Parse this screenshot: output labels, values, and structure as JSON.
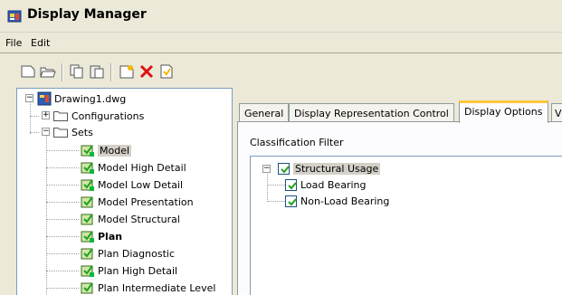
{
  "window": {
    "title": "Display Manager"
  },
  "menu": {
    "file": "File",
    "edit": "Edit"
  },
  "tree": {
    "root": "Drawing1.dwg",
    "configurations": "Configurations",
    "sets": "Sets",
    "items": [
      {
        "label": "Model",
        "selected": true,
        "bold": false
      },
      {
        "label": "Model High Detail"
      },
      {
        "label": "Model Low Detail"
      },
      {
        "label": "Model Presentation"
      },
      {
        "label": "Model Structural"
      },
      {
        "label": "Plan",
        "bold": true
      },
      {
        "label": "Plan Diagnostic"
      },
      {
        "label": "Plan High Detail"
      },
      {
        "label": "Plan Intermediate Level"
      }
    ]
  },
  "tabs": [
    {
      "label": "General"
    },
    {
      "label": "Display Representation Control"
    },
    {
      "label": "Display Options",
      "active": true
    },
    {
      "label": "V"
    }
  ],
  "filter": {
    "label": "Classification Filter",
    "root": "Structural Usage",
    "children": [
      "Load Bearing",
      "Non-Load Bearing"
    ]
  },
  "colors": {
    "check": "#21a121",
    "selection": "#d4d0c8",
    "active_tab_accent": "#ffc83c"
  }
}
